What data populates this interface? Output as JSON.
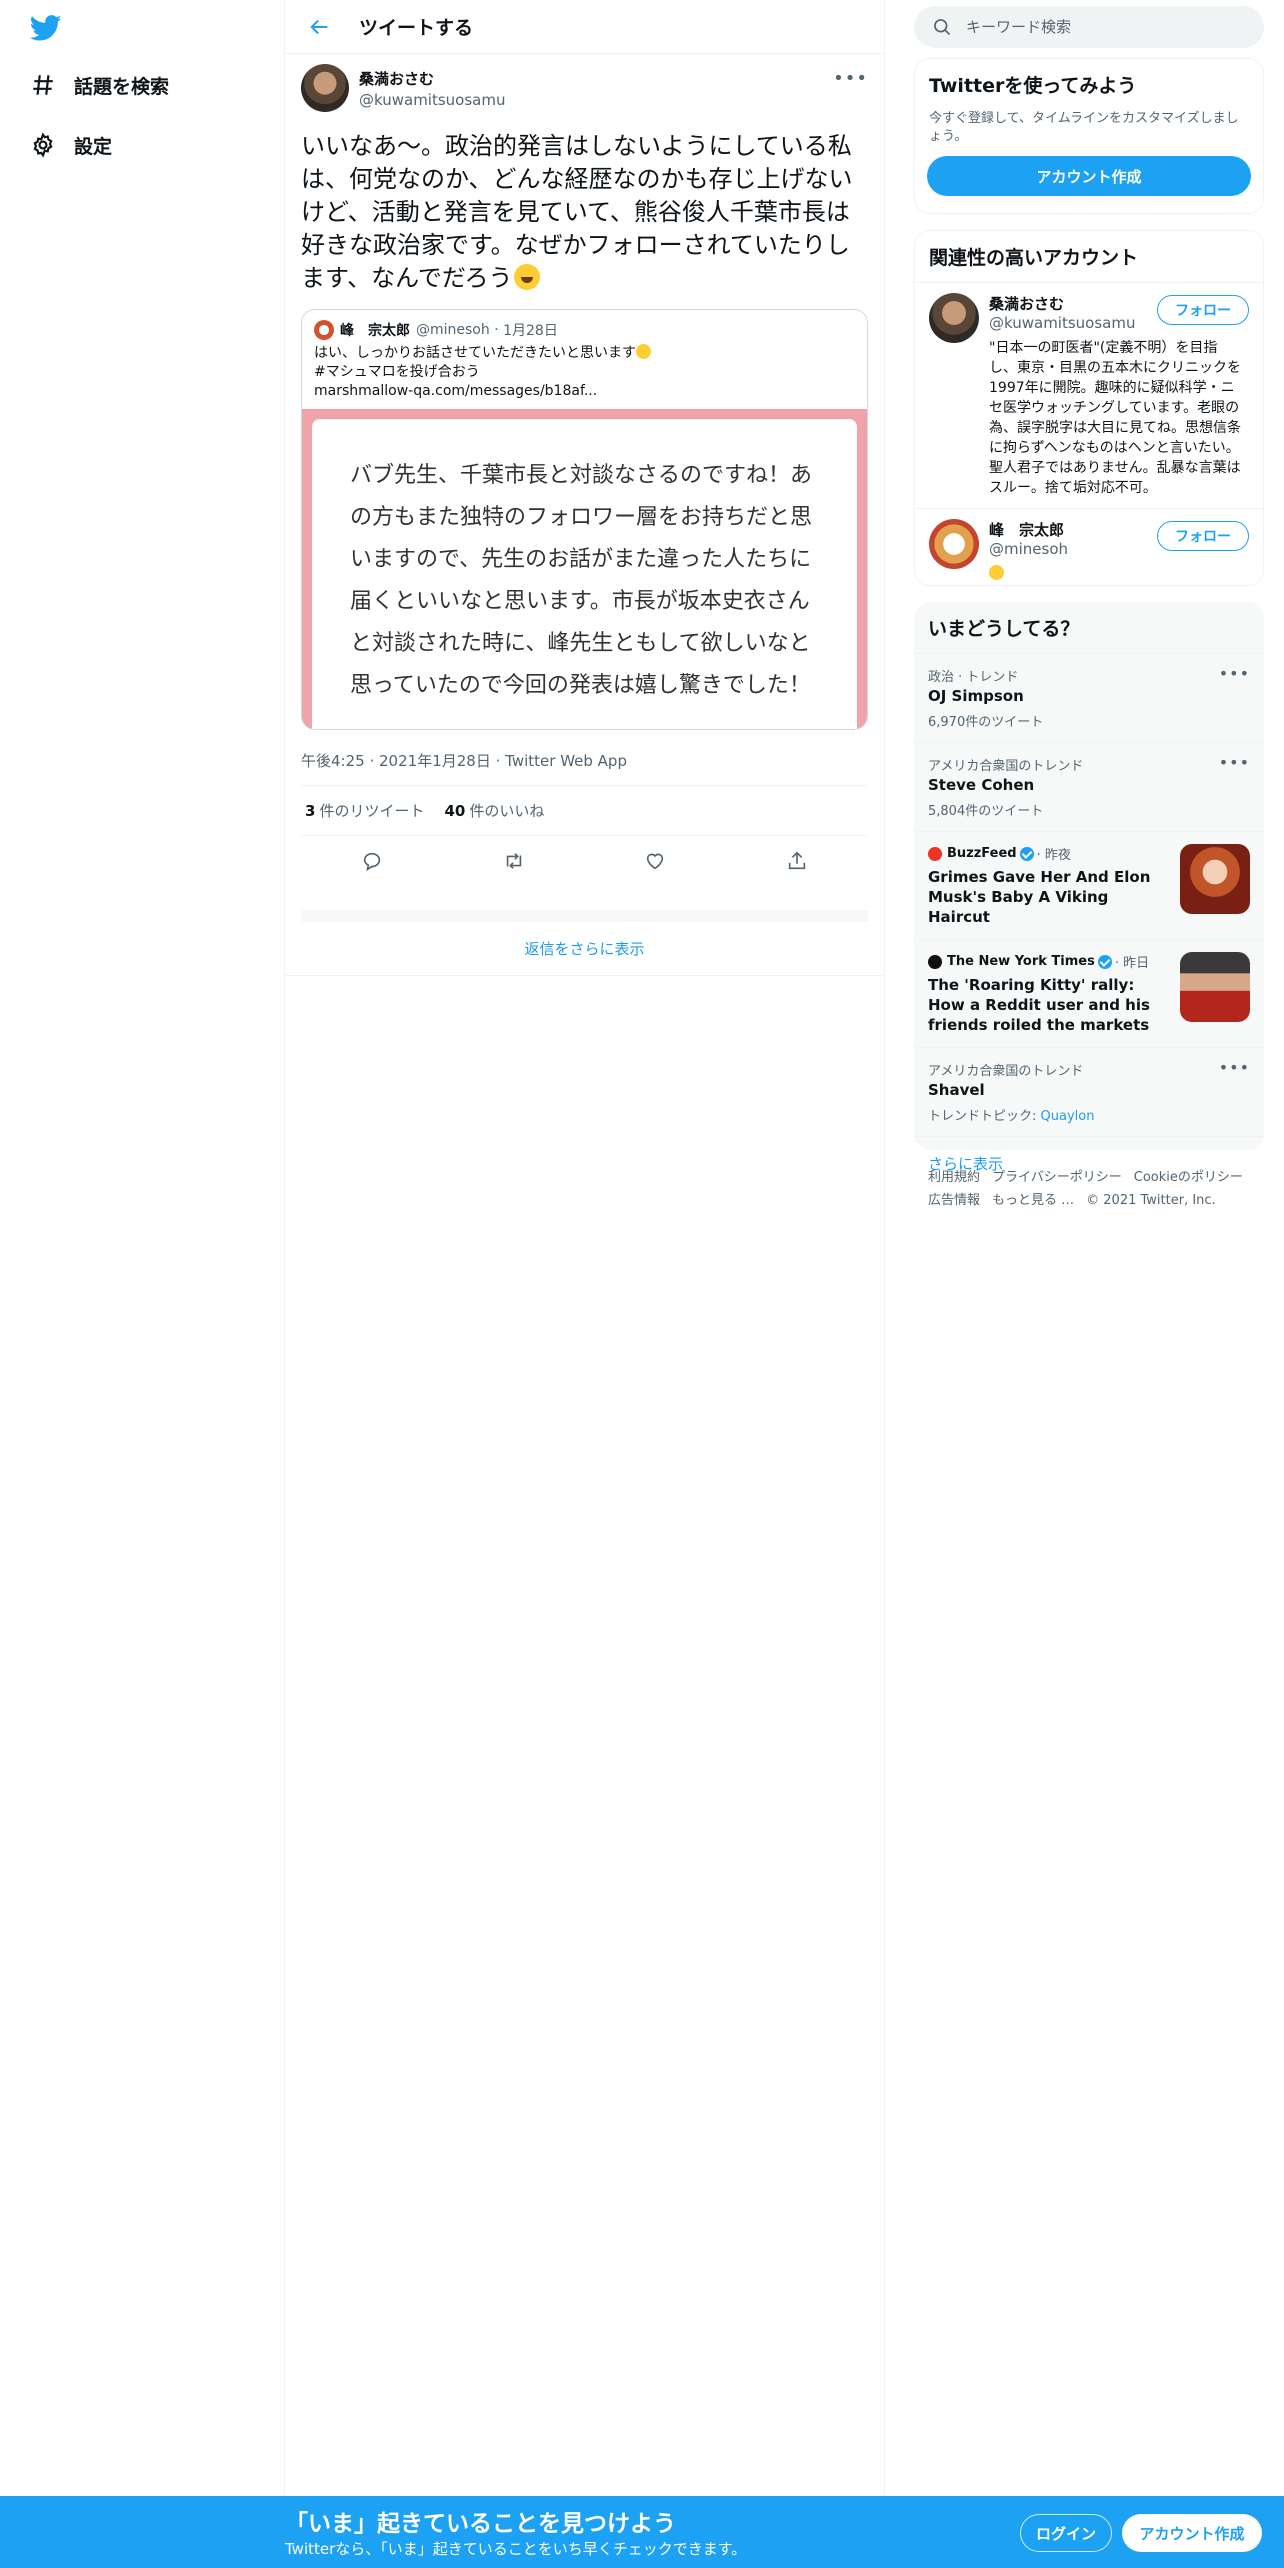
{
  "nav": {
    "items": [
      {
        "label": "話題を検索",
        "icon": "hashtag-icon"
      },
      {
        "label": "設定",
        "icon": "gear-icon"
      }
    ]
  },
  "header": {
    "title": "ツイートする"
  },
  "tweet": {
    "author_name": "桑満おさむ",
    "author_handle": "@kuwamitsuosamu",
    "text": "いいなあ〜。政治的発言はしないようにしている私は、何党なのか、どんな経歴なのかも存じ上げないけど、活動と発言を見ていて、熊谷俊人千葉市長は好きな政治家です。なぜかフォローされていたりします、なんでだろう",
    "quote": {
      "author_name": "峰　宗太郎",
      "author_handle": "@minesoh",
      "date": "1月28日",
      "line1": "はい、しっかりお話させていただきたいと思います",
      "line2": "#マシュマロを投げ合おう",
      "line3": "marshmallow-qa.com/messages/b18af...",
      "card_text": "バブ先生、千葉市長と対談なさるのですね！あの方もまた独特のフォロワー層をお持ちだと思いますので、先生のお話がまた違った人たちに届くといいなと思います。市長が坂本史衣さんと対談された時に、峰先生ともして欲しいなと思っていたので今回の発表は嬉し驚きでした！"
    },
    "time": "午後4:25",
    "date": "2021年1月28日",
    "source": "Twitter Web App",
    "retweet_count": "3",
    "retweet_label": "件のリツイート",
    "like_count": "40",
    "like_label": "件のいいね",
    "more_replies": "返信をさらに表示"
  },
  "search": {
    "placeholder": "キーワード検索"
  },
  "signup_box": {
    "title": "Twitterを使ってみよう",
    "desc": "今すぐ登録して、タイムラインをカスタマイズしましょう。",
    "button": "アカウント作成"
  },
  "related": {
    "title": "関連性の高いアカウント",
    "accounts": [
      {
        "name": "桑満おさむ",
        "handle": "@kuwamitsuosamu",
        "bio": "\"日本一の町医者\"(定義不明）を目指し、東京・目黒の五本木にクリニックを1997年に開院。趣味的に疑似科学・ニセ医学ウォッチングしています。老眼の為、誤字脱字は大目に見てね。思想信条に拘らずヘンなものはヘンと言いたい。聖人君子ではありません。乱暴な言葉はスルー。捨て垢対応不可。",
        "follow": "フォロー"
      },
      {
        "name": "峰　宗太郎",
        "handle": "@minesoh",
        "bio": "",
        "follow": "フォロー"
      }
    ]
  },
  "trends": {
    "title": "いまどうしてる？",
    "items": [
      {
        "context": "政治 · トレンド",
        "name": "OJ Simpson",
        "count": "6,970件のツイート"
      },
      {
        "context": "アメリカ合衆国のトレンド",
        "name": "Steve Cohen",
        "count": "5,804件のツイート"
      }
    ],
    "news": [
      {
        "source": "BuzzFeed",
        "time": "· 昨夜",
        "headline": "Grimes Gave Her And Elon Musk's Baby A Viking Haircut"
      },
      {
        "source": "The New York Times",
        "time": "· 昨日",
        "headline": "The 'Roaring Kitty' rally: How a Reddit user and his friends roiled the markets"
      }
    ],
    "last": {
      "context": "アメリカ合衆国のトレンド",
      "name": "Shavel",
      "topic_label": "トレンドトピック:",
      "topic": "Quaylon"
    },
    "show_more": "さらに表示"
  },
  "footer": {
    "links": [
      "利用規約",
      "プライバシーポリシー",
      "Cookieのポリシー",
      "広告情報",
      "もっと見る …"
    ],
    "copyright": "© 2021 Twitter, Inc."
  },
  "bottom_bar": {
    "headline": "「いま」起きていることを見つけよう",
    "subline": "Twitterなら、「いま」起きていることをいち早くチェックできます。",
    "login": "ログイン",
    "signup": "アカウント作成"
  },
  "colors": {
    "brand": "#1da1f2",
    "link": "#1d9bf0",
    "card_pink": "#f0a3a8"
  }
}
